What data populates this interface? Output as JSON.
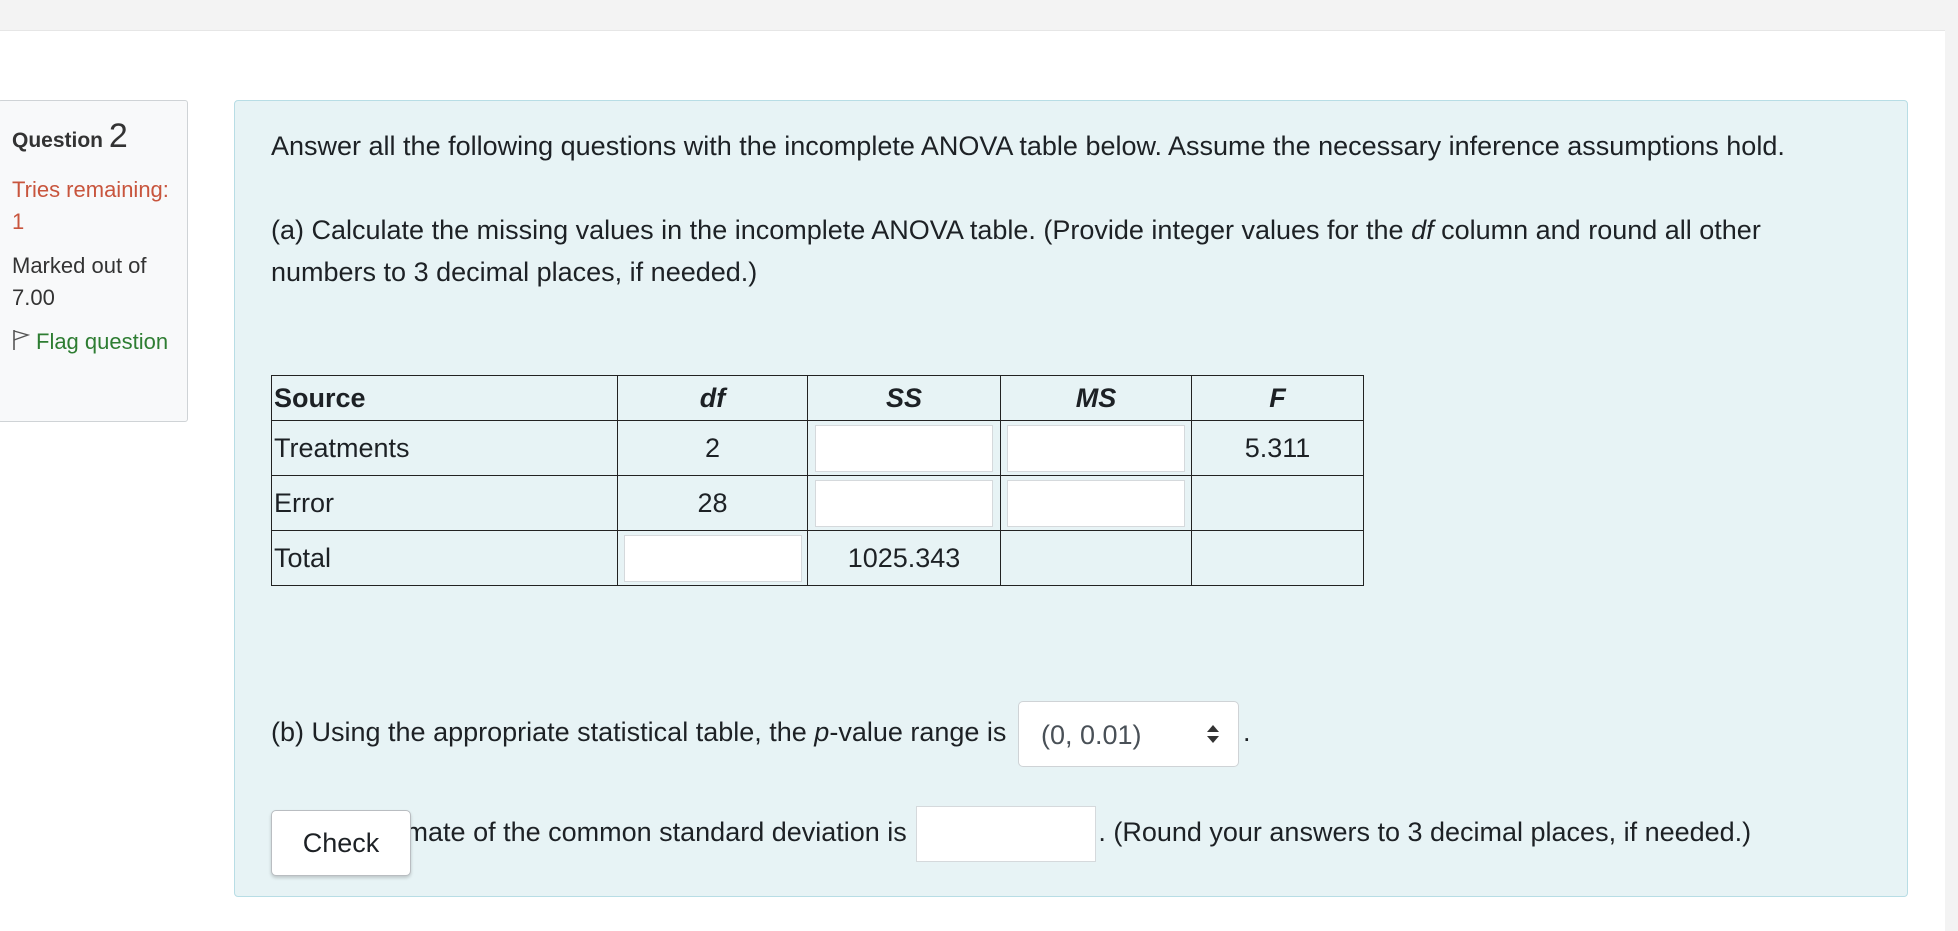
{
  "info": {
    "question_label": "Question",
    "question_number": "2",
    "tries_remaining": "Tries remaining: 1",
    "marked_out_of": "Marked out of 7.00",
    "flag_label": "Flag question"
  },
  "question": {
    "intro": "Answer all the following questions with the incomplete ANOVA table below. Assume the necessary inference assumptions hold.",
    "part_a": {
      "prefix": "(a) Calculate the missing values in the incomplete ANOVA table. (Provide integer values for the ",
      "italic": "df",
      "suffix": " column and round all other numbers to 3 decimal places, if needed.)"
    },
    "table": {
      "headers": [
        "Source",
        "df",
        "SS",
        "MS",
        "F"
      ],
      "rows": [
        {
          "source": "Treatments",
          "df": "2",
          "ss": "",
          "ms": "",
          "f": "5.311"
        },
        {
          "source": "Error",
          "df": "28",
          "ss": "",
          "ms": "",
          "f": ""
        },
        {
          "source": "Total",
          "df": "",
          "ss": "1025.343",
          "ms": "",
          "f": ""
        }
      ]
    },
    "part_b": {
      "prefix": "(b) Using the appropriate statistical table, the ",
      "italic": "p",
      "middle": "-value range is",
      "select_value": "(0, 0.01)",
      "suffix": "."
    },
    "part_c": {
      "prefix": "(c) The estimate of the common standard deviation is",
      "input_value": "",
      "suffix": ". (Round your answers to 3 decimal places, if needed.)"
    },
    "check_label": "Check"
  },
  "colors": {
    "content_bg": "#e7f3f5",
    "tries_color": "#c8553d",
    "flag_color": "#2e7d32"
  }
}
